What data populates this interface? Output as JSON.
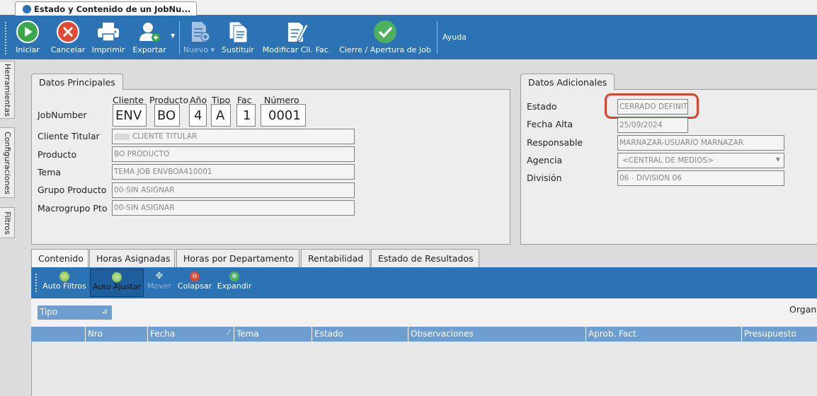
{
  "window": {
    "title": "Estado y Contenido de un JobNu..."
  },
  "toolbar": {
    "iniciar": "Iniciar",
    "cancelar": "Cancelar",
    "imprimir": "Imprimir",
    "exportar": "Exportar",
    "nuevo": "Nuevo",
    "sustituir": "Sustituir",
    "modificar": "Modificar Cli. Fac.",
    "cierre": "Cierre / Apertura de Job",
    "ayuda": "Ayuda"
  },
  "side_tabs": [
    "Herramientas",
    "Configuraciones",
    "Filtros"
  ],
  "principal": {
    "tab": "Datos Principales",
    "jobnumber_label": "JobNumber",
    "col_cliente": "Cliente",
    "col_producto": "Producto",
    "col_anio": "Año",
    "col_tipo": "Tipo",
    "col_fac": "Fac",
    "col_numero": "Número",
    "job": {
      "cliente": "ENV",
      "producto": "BO",
      "anio": "4",
      "tipo": "A",
      "fac": "1",
      "numero": "0001"
    },
    "cliente_titular_label": "Cliente Titular",
    "cliente_titular_value": "CLIENTE TITULAR",
    "producto_label": "Producto",
    "producto_value": "BO PRODUCTO",
    "tema_label": "Tema",
    "tema_value": "TEMA JOB ENVBOA410001",
    "grupo_label": "Grupo Producto",
    "grupo_value": "00-SIN ASIGNAR",
    "macrogrupo_label": "Macrogrupo Pto",
    "macrogrupo_value": "00-SIN ASIGNAR"
  },
  "adicional": {
    "tab": "Datos Adicionales",
    "estado_label": "Estado",
    "estado_value": "CERRADO DEFINITI",
    "fecha_label": "Fecha Alta",
    "fecha_value": "25/09/2024",
    "responsable_label": "Responsable",
    "responsable_value": "MARNAZAR-USUARIO MARNAZAR",
    "agencia_label": "Agencia",
    "agencia_value": "<CENTRAL DE MEDIOS>",
    "division_label": "División",
    "division_value": "06 - DIVISION 06",
    "highlight_color": "#d9432f"
  },
  "bottom_tabs": [
    "Contenido",
    "Horas Asignadas",
    "Horas por Departamento",
    "Rentabilidad",
    "Estado de Resultados"
  ],
  "subtoolbar": {
    "auto_filtros": "Auto Filtros",
    "auto_ajustar": "Auto Ajustar",
    "mover": "Mover",
    "colapsar": "Colapsar",
    "expandir": "Expandir"
  },
  "group": {
    "field": "Tipo",
    "organizer": "Organi"
  },
  "grid_columns": [
    "Nro",
    "Fecha",
    "Tema",
    "Estado",
    "Observaciones",
    "Aprob. Fact.",
    "Presupuesto"
  ]
}
